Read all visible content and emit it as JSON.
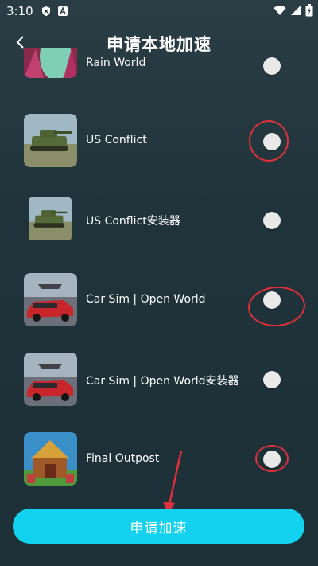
{
  "status_bar": {
    "time": "3:10"
  },
  "header": {
    "title": "申请本地加速",
    "back_icon": "chevron-left-icon"
  },
  "apps": [
    {
      "name": "Rain World",
      "selected": false
    },
    {
      "name": "US Conflict",
      "selected": false
    },
    {
      "name": "US Conflict安装器",
      "selected": false
    },
    {
      "name": "Car Sim | Open World",
      "selected": false
    },
    {
      "name": "Car Sim | Open World安装器",
      "selected": false
    },
    {
      "name": "Final Outpost",
      "selected": false
    }
  ],
  "footer": {
    "apply_label": "申请加速"
  },
  "colors": {
    "accent": "#13d2ef",
    "annotation": "#e0303a",
    "background": "#22343c"
  }
}
